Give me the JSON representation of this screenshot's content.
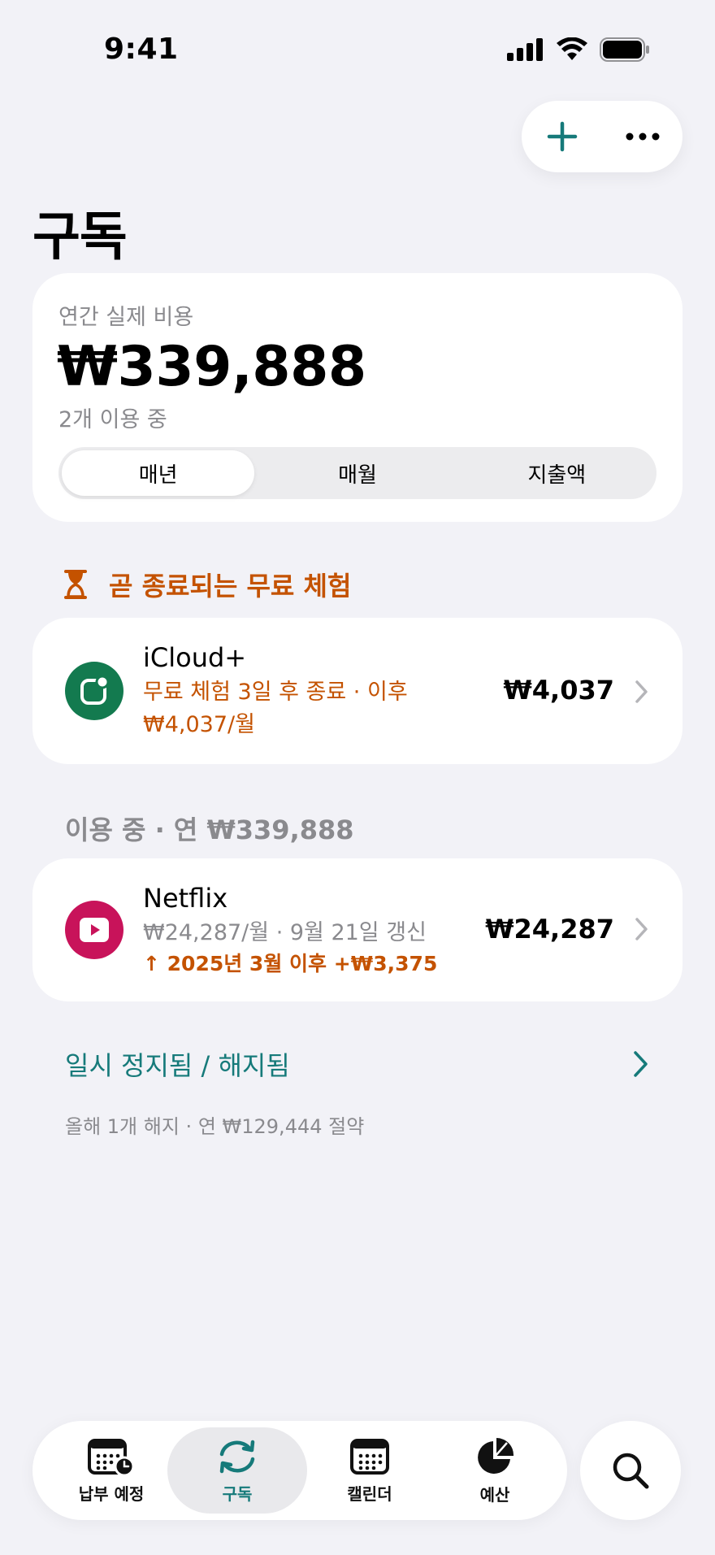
{
  "status_bar": {
    "time": "9:41"
  },
  "page": {
    "title": "구독"
  },
  "summary": {
    "label": "연간 실제 비용",
    "amount": "₩339,888",
    "count": "2개 이용 중",
    "segments": [
      {
        "label": "매년",
        "active": true
      },
      {
        "label": "매월",
        "active": false
      },
      {
        "label": "지출액",
        "active": false
      }
    ]
  },
  "trials": {
    "header": "곧 종료되는 무료 체험",
    "items": [
      {
        "name": "iCloud+",
        "line1": "무료 체험 3일 후 종료 · 이후",
        "line2": "₩4,037/월",
        "price": "₩4,037",
        "icon": "icloud-icon",
        "color": "#137a4f"
      }
    ]
  },
  "active": {
    "header": "이용 중 · 연 ₩339,888",
    "items": [
      {
        "name": "Netflix",
        "line1": "₩24,287/월 · 9월 21일 갱신",
        "line2": "↑ 2025년 3월 이후 +₩3,375",
        "price": "₩24,287",
        "icon": "play-icon",
        "color": "#c8135a"
      }
    ]
  },
  "paused": {
    "label": "일시 정지됨 / 해지됨",
    "note": "올해 1개 해지 · 연 ₩129,444 절약"
  },
  "tabbar": {
    "tabs": [
      {
        "label": "납부 예정",
        "icon": "calendar-clock-icon",
        "active": false
      },
      {
        "label": "구독",
        "icon": "sync-icon",
        "active": true
      },
      {
        "label": "캘린더",
        "icon": "calendar-icon",
        "active": false
      },
      {
        "label": "예산",
        "icon": "pie-chart-icon",
        "active": false
      }
    ]
  },
  "colors": {
    "accent": "#167a7a",
    "warning": "#c45200",
    "background": "#f2f2f7"
  }
}
